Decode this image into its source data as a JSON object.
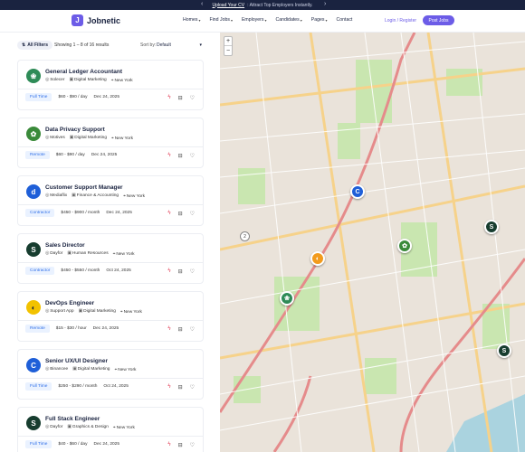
{
  "promo": {
    "link": "Upload Your CV",
    "text": ": Attract Top Employers Instantly."
  },
  "header": {
    "logo_mark": "J",
    "brand": "Jobnetic",
    "nav": [
      "Homes",
      "Find Jobs",
      "Employers",
      "Candidates",
      "Pages",
      "Contact"
    ],
    "login": "Login / Register",
    "post_jobs": "Post Jobs"
  },
  "toolbar": {
    "all_filters": "All Filters",
    "showing": "Showing 1 – 8 of 16 results",
    "sort_label": "Sort by:",
    "sort_value": "Default"
  },
  "jobs": [
    {
      "title": "General Ledger Accountant",
      "company": "Solecer",
      "category": "Digital Marketing",
      "location": "New York",
      "type": "Full Time",
      "salary": "$60 - $90 / day",
      "date": "Dec 24, 2025",
      "logo_color": "#2e8b57",
      "logo_glyph": "❀"
    },
    {
      "title": "Data Privacy Support",
      "company": "Motives",
      "category": "Digital Marketing",
      "location": "New York",
      "type": "Remote",
      "salary": "$60 - $90 / day",
      "date": "Dec 24, 2025",
      "logo_color": "#3a8a3a",
      "logo_glyph": "✿"
    },
    {
      "title": "Customer Support Manager",
      "company": "Mediaflix",
      "category": "Finance & Accounting",
      "location": "New York",
      "type": "Contractor",
      "salary": "$450 - $900 / month",
      "date": "Dec 24, 2025",
      "logo_color": "#1f5fd8",
      "logo_glyph": "d"
    },
    {
      "title": "Sales Director",
      "company": "Dayfor",
      "category": "Human Resources",
      "location": "New York",
      "type": "Contractor",
      "salary": "$450 - $550 / month",
      "date": "Oct 24, 2025",
      "logo_color": "#173d2f",
      "logo_glyph": "S"
    },
    {
      "title": "DevOps Engineer",
      "company": "Support App",
      "category": "Digital Marketing",
      "location": "New York",
      "type": "Remote",
      "salary": "$15 - $30 / hour",
      "date": "Dec 24, 2025",
      "logo_color": "#f2c200",
      "logo_glyph": "◐"
    },
    {
      "title": "Senior UX/UI Designer",
      "company": "Binancee",
      "category": "Digital Marketing",
      "location": "New York",
      "type": "Full Time",
      "salary": "$250 - $290 / month",
      "date": "Oct 24, 2025",
      "logo_color": "#1f5fd8",
      "logo_glyph": "C"
    },
    {
      "title": "Full Stack Engineer",
      "company": "Dayfor",
      "category": "Graphics & Design",
      "location": "New York",
      "type": "Full Time",
      "salary": "$40 - $60 / day",
      "date": "Dec 24, 2025",
      "logo_color": "#173d2f",
      "logo_glyph": "S"
    }
  ],
  "map": {
    "zoom_in": "+",
    "zoom_out": "−",
    "cluster_count": "2",
    "markers": [
      {
        "glyph": "C",
        "color": "#1f5fd8"
      },
      {
        "glyph": "S",
        "color": "#173d2f"
      },
      {
        "glyph": "✿",
        "color": "#3a8a3a"
      },
      {
        "glyph": "◐",
        "color": "#f29b1d"
      },
      {
        "glyph": "❀",
        "color": "#2e8b57"
      },
      {
        "glyph": "S",
        "color": "#173d2f"
      }
    ]
  }
}
